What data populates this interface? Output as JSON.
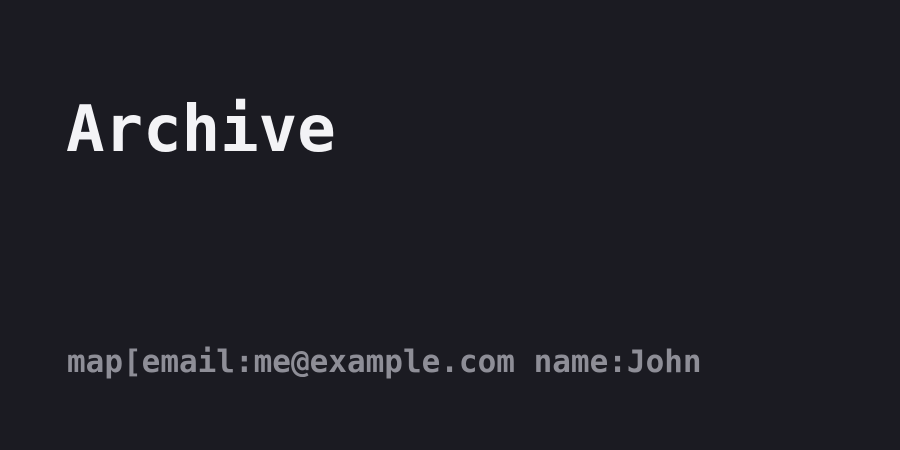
{
  "page": {
    "title": "Archive",
    "author_line": "map[email:me@example.com name:John"
  }
}
